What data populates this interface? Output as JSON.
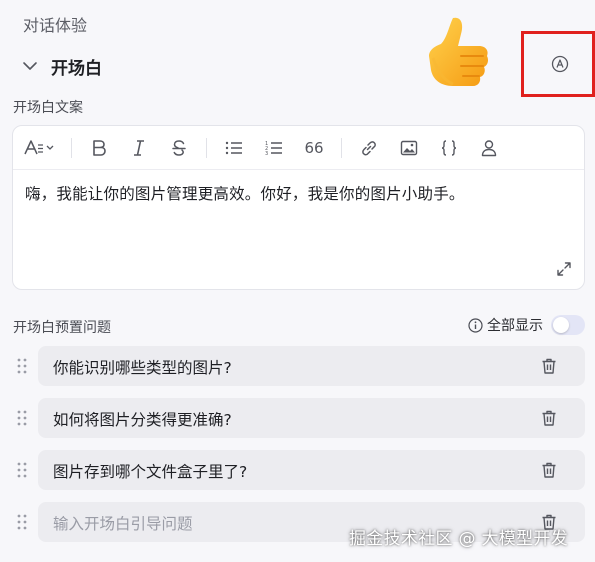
{
  "section": {
    "title": "对话体验"
  },
  "opening": {
    "title": "开场白"
  },
  "copy": {
    "label": "开场白文案",
    "content": "嗨，我能让你的图片管理更高效。你好，我是你的图片小助手。"
  },
  "toolbar": {
    "items": [
      "text-style-icon",
      "bold-icon",
      "italic-icon",
      "strikethrough-icon",
      "bullet-list-icon",
      "numbered-list-icon",
      "quote-icon",
      "link-icon",
      "image-icon",
      "code-block-icon",
      "user-icon"
    ],
    "quote_label": "66"
  },
  "preset": {
    "label": "开场白预置问题",
    "show_all_label": "全部显示",
    "show_all_enabled": false,
    "questions": [
      "你能识别哪些类型的图片?",
      "如何将图片分类得更准确?",
      "图片存到哪个文件盒子里了?"
    ],
    "input_placeholder": "输入开场白引导问题"
  },
  "watermark": "掘金技术社区 @ 大模型开发",
  "colors": {
    "highlight": "#e0201d",
    "background": "#f7f7fa",
    "question_bg": "#ececf0"
  }
}
